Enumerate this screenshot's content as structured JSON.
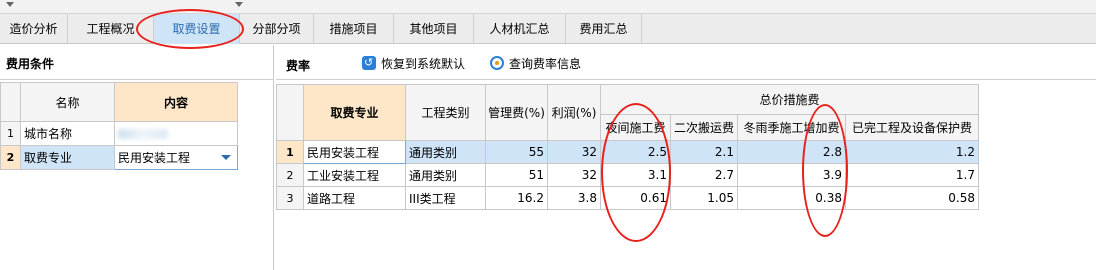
{
  "tabs": [
    {
      "label": "造价分析"
    },
    {
      "label": "工程概况"
    },
    {
      "label": "取费设置"
    },
    {
      "label": "分部分项"
    },
    {
      "label": "措施项目"
    },
    {
      "label": "其他项目"
    },
    {
      "label": "人材机汇总"
    },
    {
      "label": "费用汇总"
    }
  ],
  "active_tab": "取费设置",
  "left": {
    "title": "费用条件",
    "columns": {
      "name": "名称",
      "content": "内容"
    },
    "rows": [
      {
        "no": "1",
        "name": "城市名称",
        "content": ""
      },
      {
        "no": "2",
        "name": "取费专业",
        "content": "民用安装工程"
      }
    ]
  },
  "right": {
    "title": "费率",
    "restore_btn": "恢复到系统默认",
    "query_btn": "查询费率信息",
    "headers": {
      "specialty": "取费专业",
      "category": "工程类别",
      "mgmt": "管理费(%)",
      "profit": "利润(%)",
      "group": "总价措施费",
      "night": "夜间施工费",
      "second": "二次搬运费",
      "winter": "冬雨季施工增加费",
      "protect": "已完工程及设备保护费"
    },
    "rows": [
      {
        "no": "1",
        "specialty": "民用安装工程",
        "category": "通用类别",
        "mgmt": "55",
        "profit": "32",
        "night": "2.5",
        "second": "2.1",
        "winter": "2.8",
        "protect": "1.2"
      },
      {
        "no": "2",
        "specialty": "工业安装工程",
        "category": "通用类别",
        "mgmt": "51",
        "profit": "32",
        "night": "3.1",
        "second": "2.7",
        "winter": "3.9",
        "protect": "1.7"
      },
      {
        "no": "3",
        "specialty": "道路工程",
        "category": "III类工程",
        "mgmt": "16.2",
        "profit": "3.8",
        "night": "0.61",
        "second": "1.05",
        "winter": "0.38",
        "protect": "0.58"
      }
    ]
  },
  "colors": {
    "highlight": "#e8211c",
    "selected_row": "#cfe4f7",
    "header_accent": "#fde7c8"
  }
}
